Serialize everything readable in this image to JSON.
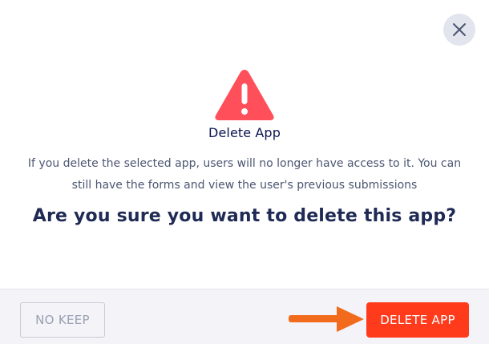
{
  "dialog": {
    "title": "Delete App",
    "description_line1": "If you delete the selected app, users will no longer have access to it. You can",
    "description_line2": "still have the forms and view the user's previous submissions",
    "question": "Are you sure you want to delete this app?",
    "icons": {
      "close": "close-icon",
      "warning": "warning-triangle-icon",
      "arrow": "arrow-right-icon"
    },
    "colors": {
      "warning_red": "#ff4f5a",
      "delete_button": "#ff3b1c",
      "arrow_orange": "#f26b1d",
      "footer_bg": "#f3f3f8"
    }
  },
  "footer": {
    "cancel_label": "NO KEEP",
    "confirm_label": "DELETE APP"
  }
}
